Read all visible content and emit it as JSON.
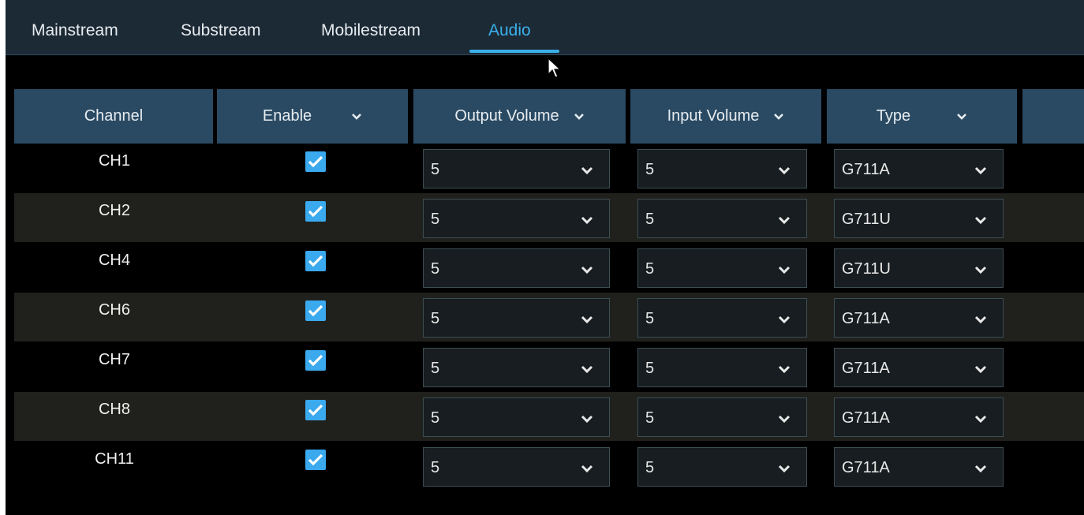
{
  "tabs": [
    {
      "label": "Mainstream",
      "active": false
    },
    {
      "label": "Substream",
      "active": false
    },
    {
      "label": "Mobilestream",
      "active": false
    },
    {
      "label": "Audio",
      "active": true
    }
  ],
  "table": {
    "headers": {
      "channel": "Channel",
      "enable": "Enable",
      "output_volume": "Output Volume",
      "input_volume": "Input Volume",
      "type": "Type"
    },
    "rows": [
      {
        "channel": "CH1",
        "enabled": true,
        "output_volume": "5",
        "input_volume": "5",
        "type": "G711A"
      },
      {
        "channel": "CH2",
        "enabled": true,
        "output_volume": "5",
        "input_volume": "5",
        "type": "G711U"
      },
      {
        "channel": "CH4",
        "enabled": true,
        "output_volume": "5",
        "input_volume": "5",
        "type": "G711U"
      },
      {
        "channel": "CH6",
        "enabled": true,
        "output_volume": "5",
        "input_volume": "5",
        "type": "G711A"
      },
      {
        "channel": "CH7",
        "enabled": true,
        "output_volume": "5",
        "input_volume": "5",
        "type": "G711A"
      },
      {
        "channel": "CH8",
        "enabled": true,
        "output_volume": "5",
        "input_volume": "5",
        "type": "G711A"
      },
      {
        "channel": "CH11",
        "enabled": true,
        "output_volume": "5",
        "input_volume": "5",
        "type": "G711A"
      }
    ]
  },
  "colors": {
    "accent": "#3ab0ea",
    "header_bg": "#2a4a63",
    "checkbox": "#3aa9ee",
    "row_alt": "#20211d"
  }
}
